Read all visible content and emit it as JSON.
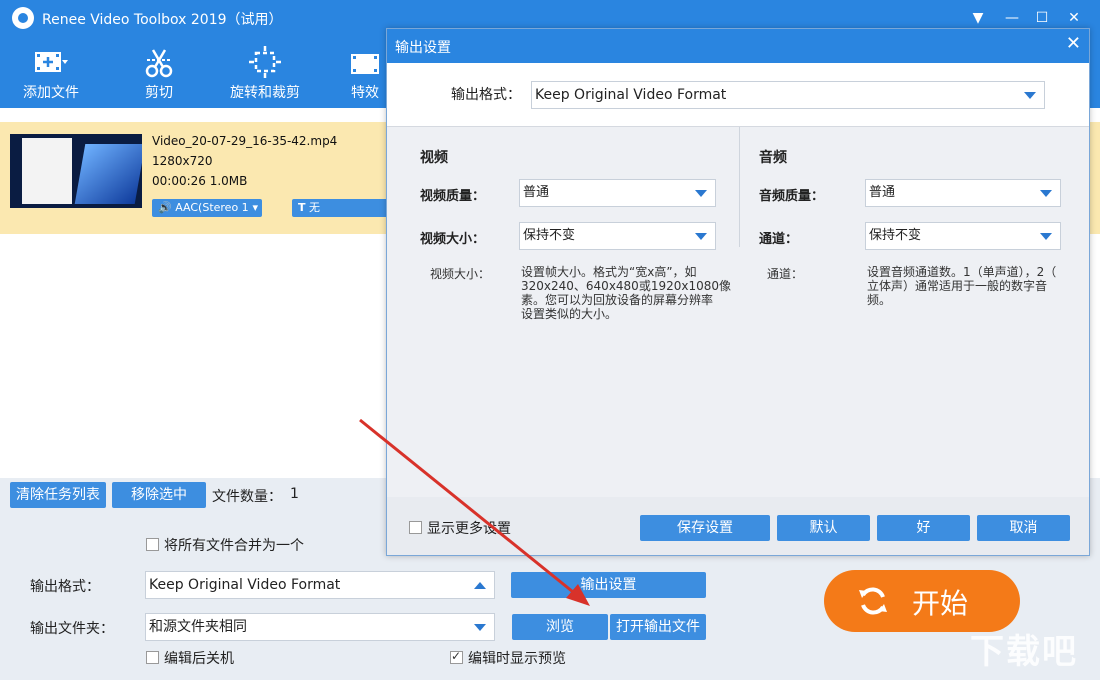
{
  "app": {
    "title": "Renee Video Toolbox 2019（试用）"
  },
  "toolbar": {
    "add_file": "添加文件",
    "cut": "剪切",
    "rotate_crop": "旋转和裁剪",
    "effects": "特效"
  },
  "file": {
    "name": "Video_20-07-29_16-35-42.mp4",
    "resolution": "1280x720",
    "duration_size": "00:00:26 1.0MB",
    "audio": "AAC(Stereo 1",
    "subtitle": "无"
  },
  "list_actions": {
    "clear_tasks": "清除任务列表",
    "remove_selected": "移除选中",
    "file_count_label": "文件数量：",
    "file_count": "1"
  },
  "bottom": {
    "merge_all": "将所有文件合并为一个",
    "output_format_label": "输出格式：",
    "output_format_value": "Keep Original Video Format",
    "output_settings": "输出设置",
    "output_folder_label": "输出文件夹：",
    "output_folder_value": "和源文件夹相同",
    "browse": "浏览",
    "open_output": "打开输出文件",
    "shutdown_after": "编辑后关机",
    "show_preview": "编辑时显示预览",
    "start": "开始"
  },
  "dialog": {
    "title": "输出设置",
    "format_label": "输出格式：",
    "format_value": "Keep Original Video Format",
    "video_section": "视频",
    "video_quality_label": "视频质量：",
    "video_quality_value": "普通",
    "video_size_label": "视频大小：",
    "video_size_value": "保持不变",
    "video_size_hint_label": "视频大小：",
    "video_size_hint_1": "设置帧大小。格式为“宽x高”，如",
    "video_size_hint_2": "320x240、640x480或1920x1080像",
    "video_size_hint_3": "素。您可以为回放设备的屏幕分辨率",
    "video_size_hint_4": "设置类似的大小。",
    "audio_section": "音频",
    "audio_quality_label": "音频质量：",
    "audio_quality_value": "普通",
    "channel_label": "通道：",
    "channel_value": "保持不变",
    "channel_hint_label": "通道：",
    "channel_hint_1": "设置音频通道数。1（单声道），2（",
    "channel_hint_2": "立体声）通常适用于一般的数字音",
    "channel_hint_3": "频。",
    "show_more": "显示更多设置",
    "save": "保存设置",
    "default": "默认",
    "ok": "好",
    "cancel": "取消"
  },
  "watermark": "下载吧",
  "colors": {
    "accent": "#2a85e0",
    "button": "#3d8ee0",
    "start": "#f47a18",
    "selected_row": "#fbe8b0",
    "arrow": "#d8322a"
  }
}
